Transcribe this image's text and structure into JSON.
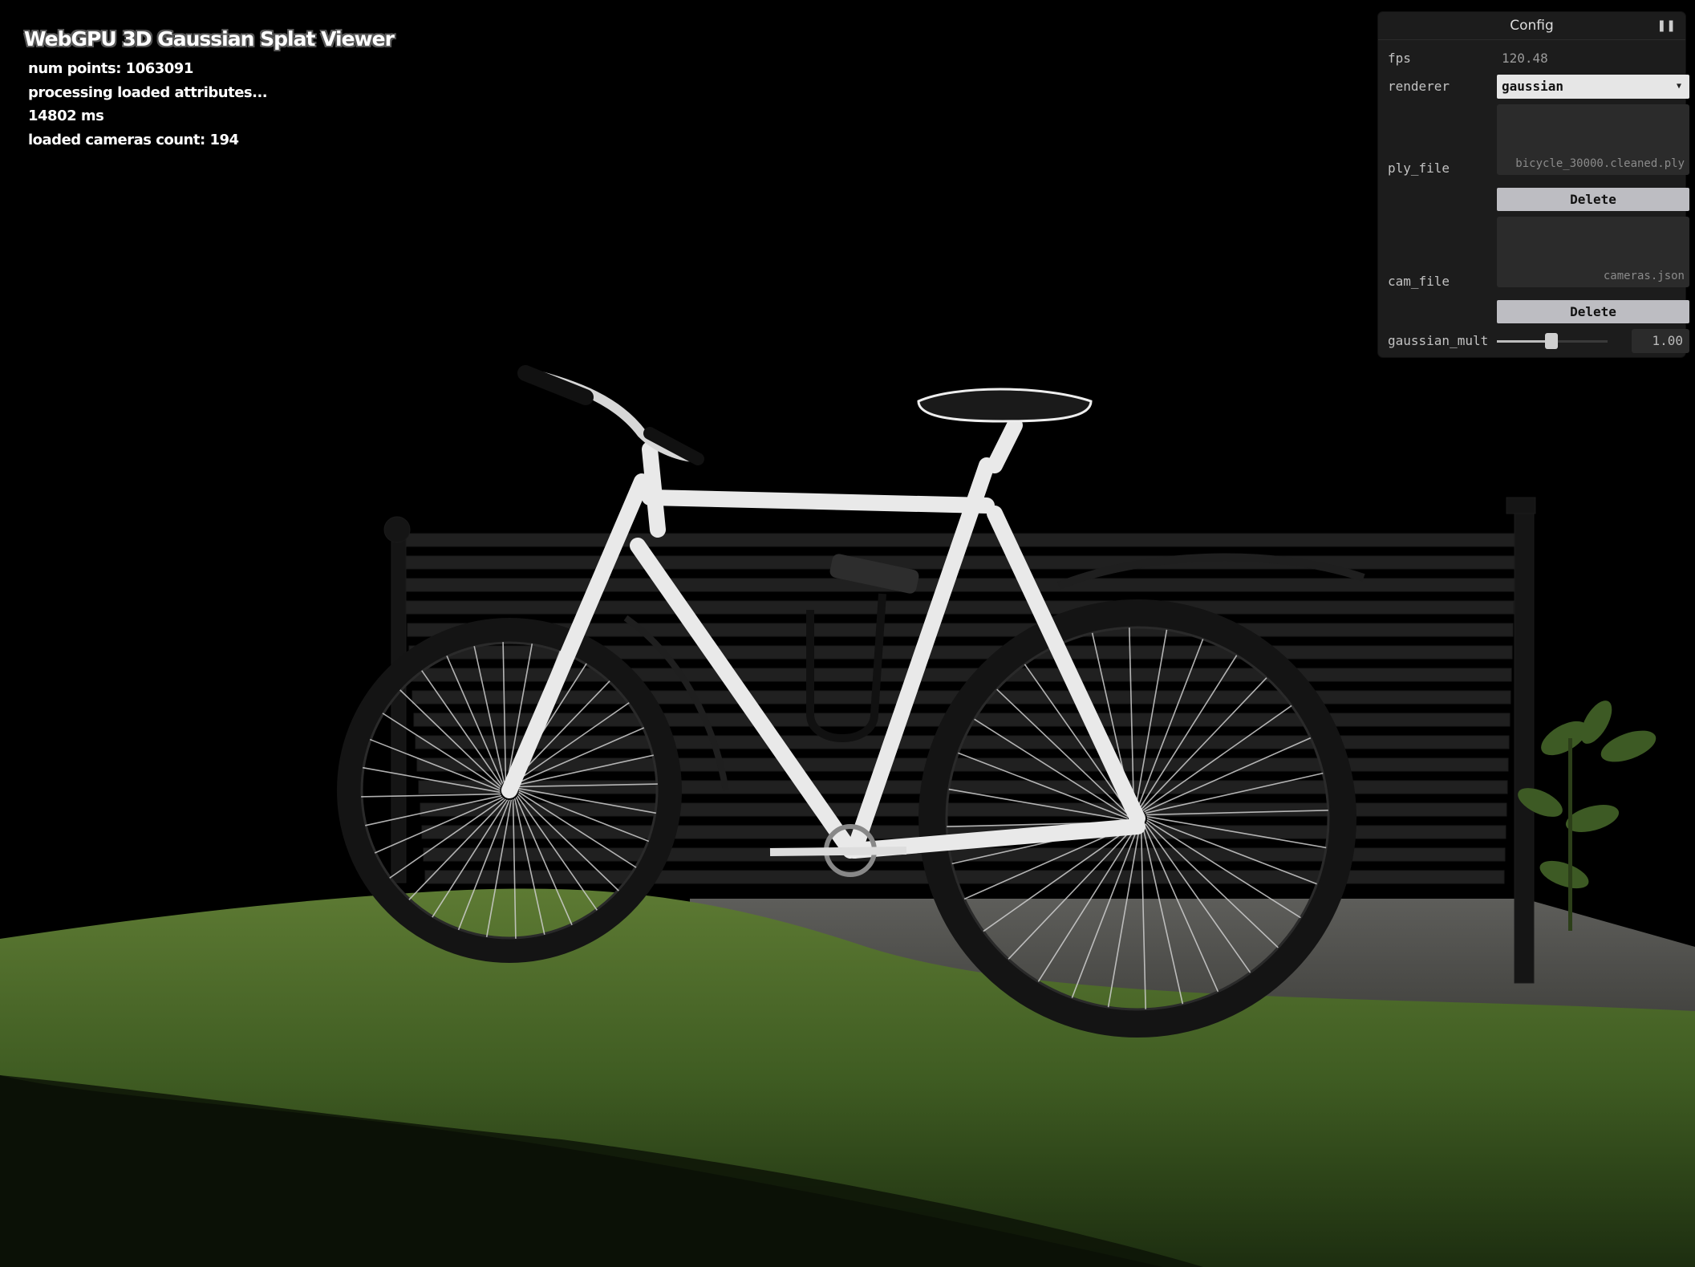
{
  "overlay": {
    "title": "WebGPU 3D Gaussian Splat Viewer",
    "lines": [
      "num points: 1063091",
      "processing loaded attributes...",
      "14802 ms",
      "loaded cameras count: 194"
    ]
  },
  "config": {
    "title": "Config",
    "collapse_icon": "collapse-icon",
    "fps": {
      "label": "fps",
      "value": "120.48"
    },
    "renderer": {
      "label": "renderer",
      "value": "gaussian"
    },
    "ply_file": {
      "label": "ply_file",
      "value": "bicycle_30000.cleaned.ply",
      "delete_label": "Delete"
    },
    "cam_file": {
      "label": "cam_file",
      "value": "cameras.json",
      "delete_label": "Delete"
    },
    "gaussian_mult": {
      "label": "gaussian_mult",
      "value": "1.00",
      "slider_fraction": 0.49
    }
  },
  "scene": {
    "subject": "white bicycle leaning on bench on grass",
    "colors": {
      "grass": "#4a6a2a",
      "bench": "#1e1e1e",
      "frame": "#e8e8e8",
      "tire": "#181818"
    }
  }
}
